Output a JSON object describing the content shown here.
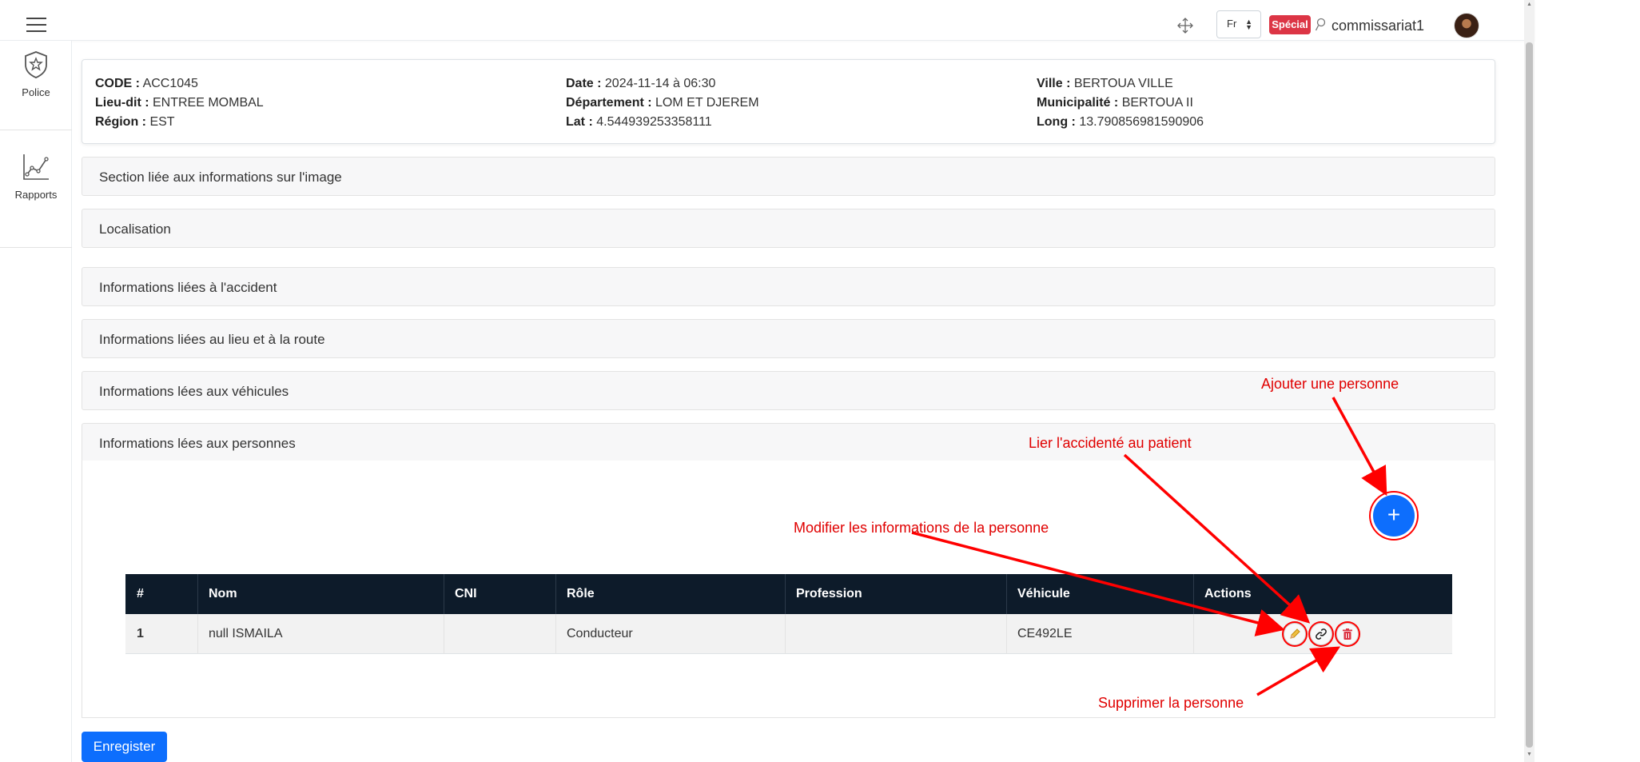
{
  "topbar": {
    "language": "Fr",
    "badge": "Spécial",
    "username": "commissariat1"
  },
  "sidebar": {
    "items": [
      {
        "label": "Police",
        "icon": "shield-star-icon"
      },
      {
        "label": "Rapports",
        "icon": "line-chart-icon"
      }
    ]
  },
  "accident": {
    "col1": [
      {
        "label": "CODE :",
        "value": "ACC1045"
      },
      {
        "label": "Lieu-dit :",
        "value": "ENTREE MOMBAL"
      },
      {
        "label": "Région :",
        "value": "EST"
      }
    ],
    "col2": [
      {
        "label": "Date :",
        "value": "2024-11-14 à 06:30"
      },
      {
        "label": "Département :",
        "value": "LOM ET DJEREM"
      },
      {
        "label": "Lat :",
        "value": "4.544939253358111"
      }
    ],
    "col3": [
      {
        "label": "Ville :",
        "value": "BERTOUA VILLE"
      },
      {
        "label": "Municipalité :",
        "value": "BERTOUA II"
      },
      {
        "label": "Long :",
        "value": "13.790856981590906"
      }
    ]
  },
  "sections": [
    "Section liée aux informations sur l'image",
    "Localisation",
    "Informations liées à l'accident",
    "Informations liées au lieu et à la route",
    "Informations lées aux véhicules",
    "Informations lées aux personnes"
  ],
  "add_button": "+",
  "table": {
    "headers": [
      "#",
      "Nom",
      "CNI",
      "Rôle",
      "Profession",
      "Véhicule",
      "Actions"
    ],
    "rows": [
      {
        "num": "1",
        "nom": "null ISMAILA",
        "cni": "",
        "role": "Conducteur",
        "profession": "",
        "vehicule": "CE492LE"
      }
    ]
  },
  "save_button": "Enregister",
  "annotations": {
    "add": "Ajouter une personne",
    "link": "Lier l'accidenté au patient",
    "edit": "Modifier les informations de la personne",
    "delete": "Supprimer la personne"
  },
  "colors": {
    "primary": "#0d6efd",
    "table_header": "#0d1b2a",
    "badge": "#dc3545",
    "annotation": "#e00000"
  }
}
